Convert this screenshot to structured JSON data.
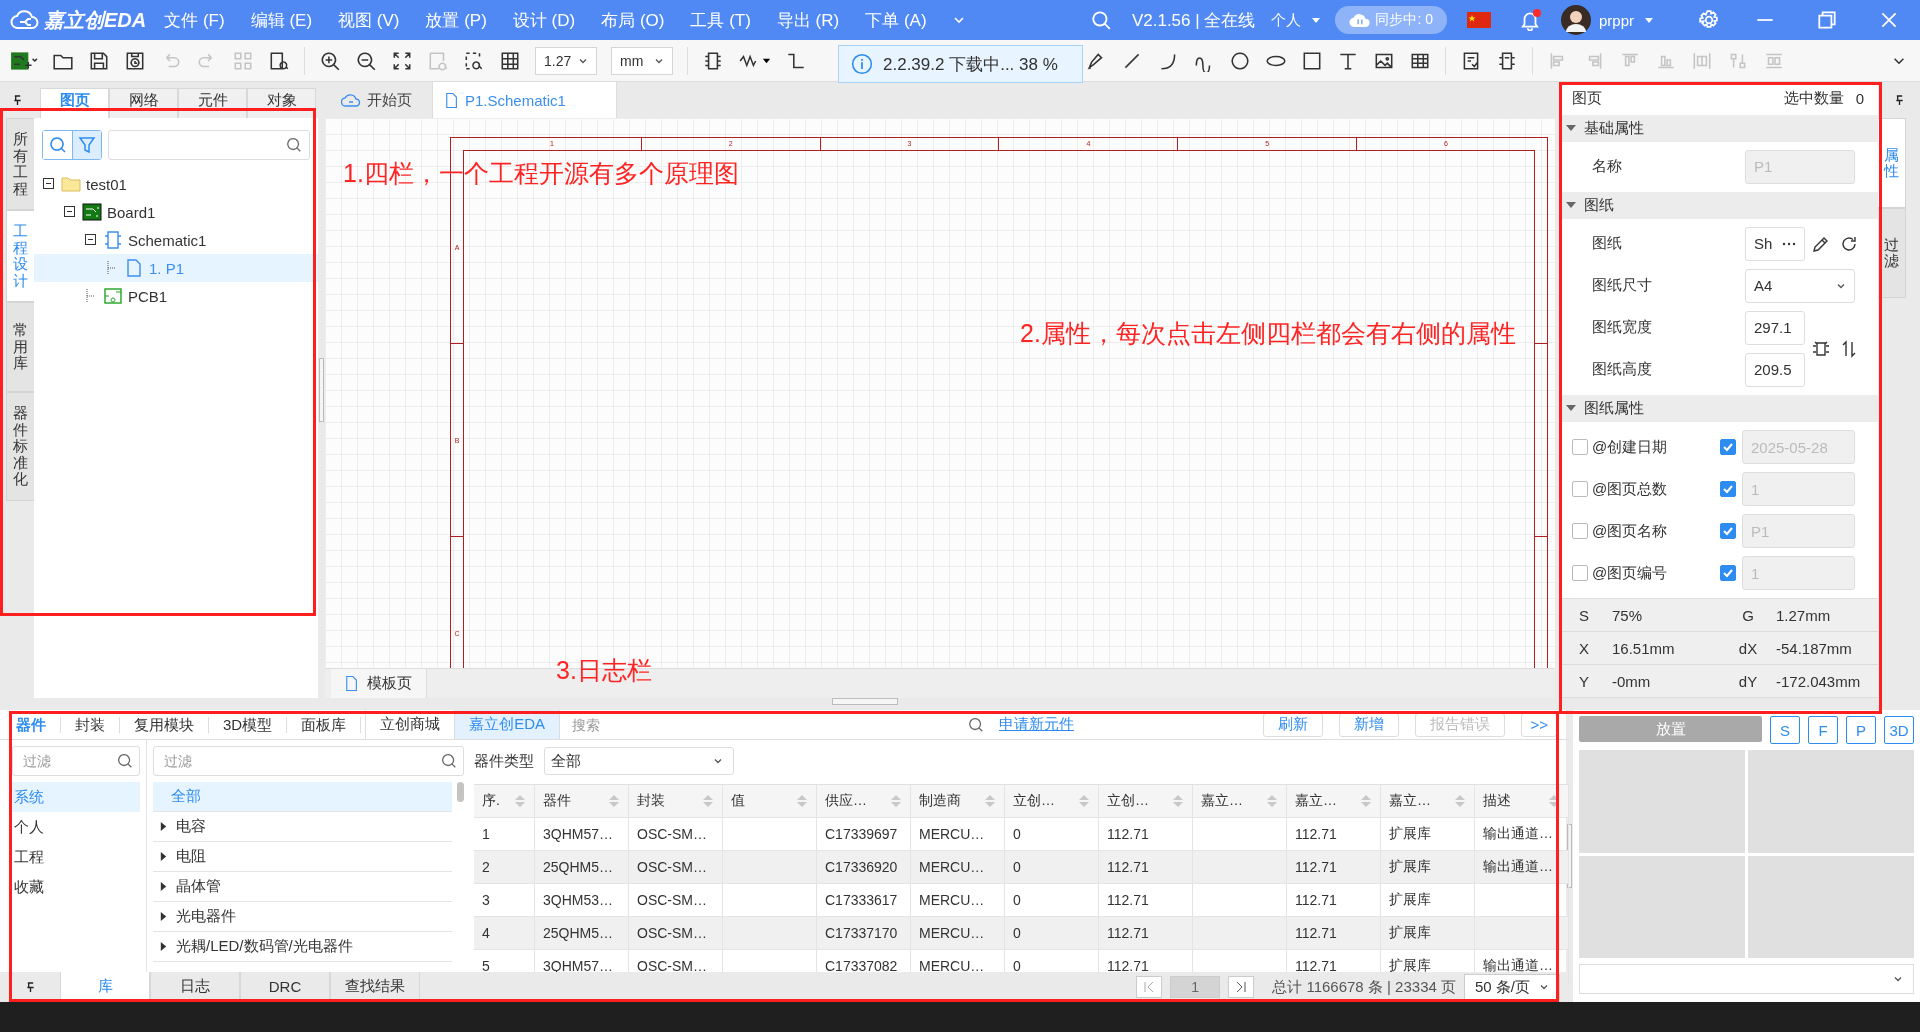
{
  "title_bar": {
    "app_name": "嘉立创EDA",
    "menus": [
      "文件 (F)",
      "编辑 (E)",
      "视图 (V)",
      "放置 (P)",
      "设计 (D)",
      "布局 (O)",
      "工具 (T)",
      "导出 (R)",
      "下单 (A)"
    ],
    "version": "V2.1.56 | 全在线",
    "account_type": "个人",
    "sync": "同步中: 0",
    "notification_dot": true,
    "user": "prppr"
  },
  "toolbar": {
    "grid_value": "1.27",
    "unit": "mm"
  },
  "download_toast": {
    "text": "2.2.39.2 下载中... 38 %"
  },
  "left_panel": {
    "side_tabs": [
      {
        "label": "所有工程",
        "selected": false
      },
      {
        "label": "工程设计",
        "selected": true
      },
      {
        "label": "常用库",
        "selected": false
      },
      {
        "label": "器件标准化",
        "selected": false
      }
    ],
    "tabs": [
      {
        "label": "图页",
        "selected": true
      },
      {
        "label": "网络",
        "selected": false
      },
      {
        "label": "元件",
        "selected": false
      },
      {
        "label": "对象",
        "selected": false
      }
    ],
    "search_buttons": [
      {
        "kind": "search",
        "selected": false
      },
      {
        "kind": "filter",
        "selected": true
      }
    ],
    "tree": [
      {
        "label": "test01",
        "kind": "folder",
        "expanded": true,
        "selected": false,
        "children": [
          {
            "label": "Board1",
            "kind": "board",
            "expanded": true,
            "selected": false,
            "children": [
              {
                "label": "Schematic1",
                "kind": "schematic",
                "expanded": true,
                "selected": false,
                "children": [
                  {
                    "label": "1. P1",
                    "kind": "page",
                    "selected": true
                  }
                ]
              },
              {
                "label": "PCB1",
                "kind": "pcb",
                "selected": false
              }
            ]
          }
        ]
      }
    ]
  },
  "editor": {
    "tabs": [
      {
        "label": "开始页",
        "kind": "home",
        "selected": false
      },
      {
        "label": "P1.Schematic1",
        "kind": "page",
        "selected": true
      }
    ],
    "column_marks": [
      "1",
      "2",
      "3",
      "4",
      "5",
      "6"
    ],
    "row_marks": [
      "A",
      "B",
      "C"
    ],
    "bottom_tab": "模板页"
  },
  "properties": {
    "title": "图页",
    "selection_label": "选中数量",
    "selection_count": "0",
    "side_tabs": [
      {
        "label": "属性",
        "selected": true
      },
      {
        "label": "过滤",
        "selected": false
      }
    ],
    "sections": [
      {
        "title": "基础属性",
        "expanded": true,
        "rows": [
          {
            "kind": "input",
            "label": "名称",
            "value": "P1",
            "disabled": true
          }
        ]
      },
      {
        "title": "图纸",
        "expanded": true,
        "rows": [
          {
            "kind": "picker",
            "label": "图纸",
            "value": "Sh"
          },
          {
            "kind": "select",
            "label": "图纸尺寸",
            "value": "A4"
          },
          {
            "kind": "number",
            "label": "图纸宽度",
            "value": "297.1"
          },
          {
            "kind": "number",
            "label": "图纸高度",
            "value": "209.5"
          }
        ]
      },
      {
        "title": "图纸属性",
        "expanded": true,
        "rows": [
          {
            "kind": "attribute",
            "label": "@创建日期",
            "shown": false,
            "checked": true,
            "value": "2025-05-28"
          },
          {
            "kind": "attribute",
            "label": "@图页总数",
            "shown": false,
            "checked": true,
            "value": "1"
          },
          {
            "kind": "attribute",
            "label": "@图页名称",
            "shown": false,
            "checked": true,
            "value": "P1"
          },
          {
            "kind": "attribute",
            "label": "@图页编号",
            "shown": false,
            "checked": true,
            "value": "1"
          }
        ]
      }
    ],
    "status": [
      {
        "label": "S",
        "value": "75%"
      },
      {
        "label": "G",
        "value": "1.27mm"
      },
      {
        "label": "X",
        "value": "16.51mm"
      },
      {
        "label": "dX",
        "value": "-54.187mm"
      },
      {
        "label": "Y",
        "value": "-0mm"
      },
      {
        "label": "dY",
        "value": "-172.043mm"
      }
    ]
  },
  "library": {
    "tabs": [
      {
        "label": "器件",
        "selected": true
      },
      {
        "label": "封装",
        "selected": false
      },
      {
        "label": "复用模块",
        "selected": false
      },
      {
        "label": "3D模型",
        "selected": false
      },
      {
        "label": "面板库",
        "selected": false
      }
    ],
    "sources": [
      {
        "label": "立创商城",
        "selected": false
      },
      {
        "label": "嘉立创EDA",
        "selected": true
      }
    ],
    "search_placeholder": "搜索",
    "request_link": "申请新元件",
    "buttons": [
      {
        "label": "刷新",
        "disabled": false
      },
      {
        "label": "新增",
        "disabled": false
      },
      {
        "label": "报告错误",
        "disabled": true
      },
      {
        "label": ">>",
        "disabled": false
      }
    ],
    "scope_filter_placeholder": "过滤",
    "scopes": [
      {
        "label": "系统",
        "selected": true
      },
      {
        "label": "个人",
        "selected": false
      },
      {
        "label": "工程",
        "selected": false
      },
      {
        "label": "收藏",
        "selected": false
      }
    ],
    "category_filter_placeholder": "过滤",
    "all_item": {
      "label": "全部",
      "selected": true
    },
    "categories": [
      {
        "label": "电容",
        "expanded": false,
        "selected": false
      },
      {
        "label": "电阻",
        "expanded": false,
        "selected": false
      },
      {
        "label": "晶体管",
        "expanded": false,
        "selected": false
      },
      {
        "label": "光电器件",
        "expanded": false,
        "selected": false
      },
      {
        "label": "光耦/LED/数码管/光电器件",
        "expanded": false,
        "selected": false
      }
    ],
    "type_label": "器件类型",
    "type_value": "全部",
    "columns": [
      "序.",
      "器件",
      "封装",
      "值",
      "供应…",
      "制造商",
      "立创…",
      "立创…",
      "嘉立…",
      "嘉立…",
      "嘉立…",
      "描述"
    ],
    "rows": [
      [
        "1",
        "3QHM57…",
        "OSC-SM…",
        null,
        "C17339697",
        "MERCU…",
        "0",
        "112.71",
        null,
        "112.71",
        "扩展库",
        "输出通道…"
      ],
      [
        "2",
        "25QHM5…",
        "OSC-SM…",
        null,
        "C17336920",
        "MERCU…",
        "0",
        "112.71",
        null,
        "112.71",
        "扩展库",
        "输出通道…"
      ],
      [
        "3",
        "3QHM53…",
        "OSC-SM…",
        null,
        "C17333617",
        "MERCU…",
        "0",
        "112.71",
        null,
        "112.71",
        "扩展库",
        null
      ],
      [
        "4",
        "25QHM5…",
        "OSC-SM…",
        null,
        "C17337170",
        "MERCU…",
        "0",
        "112.71",
        null,
        "112.71",
        "扩展库",
        null
      ],
      [
        "5",
        "3QHM57…",
        "OSC-SM…",
        null,
        "C17337082",
        "MERCU…",
        "0",
        "112.71",
        null,
        "112.71",
        "扩展库",
        "输出通道…"
      ]
    ],
    "bottom_tabs": [
      {
        "label": "库",
        "selected": true
      },
      {
        "label": "日志",
        "selected": false
      },
      {
        "label": "DRC",
        "selected": false
      },
      {
        "label": "查找结果",
        "selected": false
      }
    ],
    "page": "1",
    "total": "总计 1166678 条 | 23334 页",
    "page_size": "50 条/页"
  },
  "preview": {
    "place_button": "放置",
    "place_disabled": true,
    "view_buttons": [
      "S",
      "F",
      "P",
      "3D"
    ]
  },
  "annotations": [
    {
      "text": "1.四栏，一个工程开源有多个原理图"
    },
    {
      "text": "2.属性，每次点击左侧四栏都会有右侧的属性"
    },
    {
      "text": "3.日志栏"
    }
  ]
}
